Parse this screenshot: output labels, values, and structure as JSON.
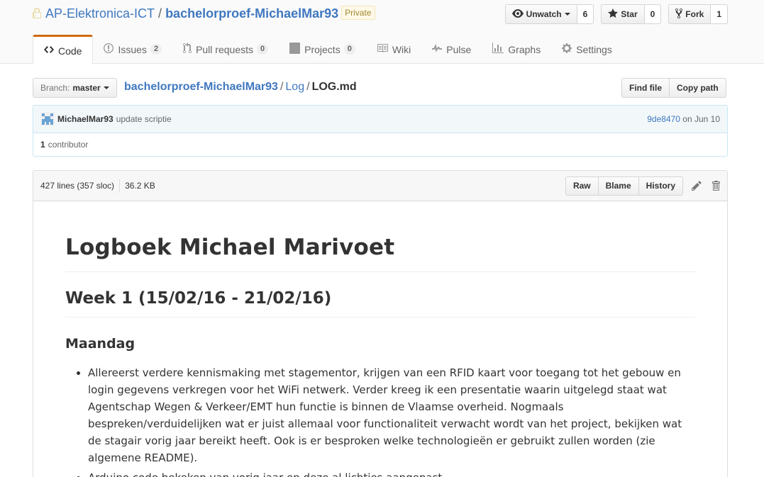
{
  "repo": {
    "owner": "AP-Elektronica-ICT",
    "separator": "/",
    "name": "bachelorproef-MichaelMar93",
    "visibility": "Private"
  },
  "actions": {
    "watch_label": "Unwatch",
    "watch_count": "6",
    "star_label": "Star",
    "star_count": "0",
    "fork_label": "Fork",
    "fork_count": "1"
  },
  "nav": {
    "code": "Code",
    "issues": "Issues",
    "issues_count": "2",
    "pulls": "Pull requests",
    "pulls_count": "0",
    "projects": "Projects",
    "projects_count": "0",
    "wiki": "Wiki",
    "pulse": "Pulse",
    "graphs": "Graphs",
    "settings": "Settings"
  },
  "branch": {
    "label": "Branch:",
    "name": "master"
  },
  "breadcrumb": {
    "root": "bachelorproef-MichaelMar93",
    "sep": "/",
    "dir": "Log",
    "file": "LOG.md"
  },
  "file_nav": {
    "find_file": "Find file",
    "copy_path": "Copy path"
  },
  "commit": {
    "author": "MichaelMar93",
    "message": "update scriptie",
    "sha": "9de8470",
    "date": "on Jun 10",
    "contributors_count": "1",
    "contributors_label": "contributor"
  },
  "file": {
    "lines": "427 lines (357 sloc)",
    "size": "36.2 KB",
    "raw": "Raw",
    "blame": "Blame",
    "history": "History"
  },
  "markdown": {
    "h1": "Logboek Michael Marivoet",
    "h2": "Week 1 (15/02/16 - 21/02/16)",
    "h3": "Maandag",
    "items": [
      "Allereerst verdere kennismaking met stagementor, krijgen van een RFID kaart voor toegang tot het gebouw en login gegevens verkregen voor het WiFi netwerk. Verder kreeg ik een presentatie waarin uitgelegd staat wat Agentschap Wegen & Verkeer/EMT hun functie is binnen de Vlaamse overheid. Nogmaals bespreken/verduidelijken wat er juist allemaal voor functionaliteit verwacht wordt van het project, bekijken wat de stagair vorig jaar bereikt heeft. Ook is er besproken welke technologieën er gebruikt zullen worden (zie algemene README).",
      "Arduino code bekeken van vorig jaar en deze al lichtjes aangepast."
    ]
  }
}
